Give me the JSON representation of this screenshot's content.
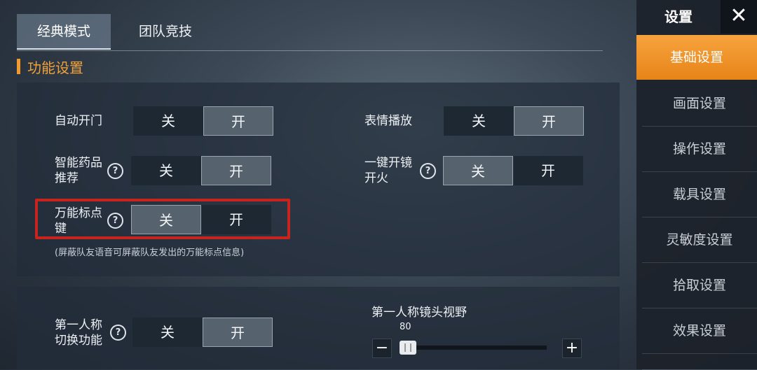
{
  "tabs": [
    "经典模式",
    "团队竞技"
  ],
  "section_title": "功能设置",
  "toggle_labels": {
    "off": "关",
    "on": "开"
  },
  "settings": {
    "auto_door": {
      "label": "自动开门",
      "state": "on"
    },
    "emote": {
      "label": "表情播放",
      "state": "on"
    },
    "smart_medicine": {
      "label1": "智能药品",
      "label2": "推荐",
      "state": "on"
    },
    "one_key_scope": {
      "label1": "一键开镜",
      "label2": "开火",
      "state": "off"
    },
    "universal_marker": {
      "label1": "万能标点",
      "label2": "键",
      "state": "off"
    },
    "universal_marker_note": "(屏蔽队友语音可屏蔽队友发出的万能标点信息)",
    "fpp_switch": {
      "label1": "第一人称",
      "label2": "切换功能",
      "state": "on"
    }
  },
  "help_symbol": "?",
  "fov": {
    "title": "第一人称镜头视野",
    "value": "80",
    "minus": "−",
    "plus": "+",
    "fill_fraction": 0.0
  },
  "sidebar": {
    "title": "设置",
    "close": "✕",
    "items": [
      "基础设置",
      "画面设置",
      "操作设置",
      "载具设置",
      "灵敏度设置",
      "拾取设置",
      "效果设置"
    ],
    "active_index": 0
  },
  "colors": {
    "accent": "#f29a2e",
    "highlight": "#c8241e"
  }
}
